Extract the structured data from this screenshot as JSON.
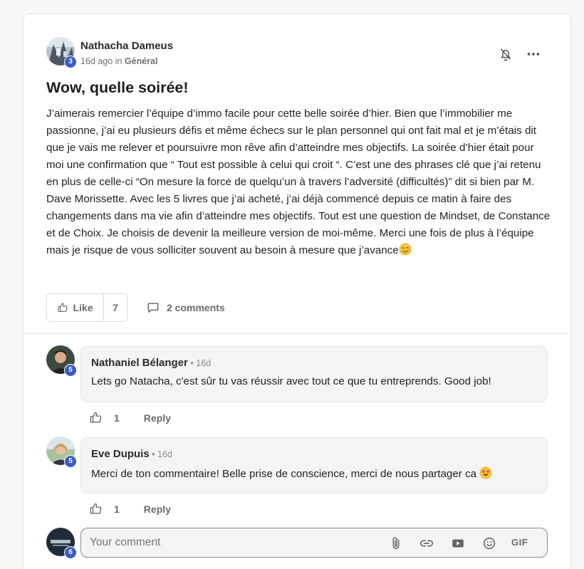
{
  "post": {
    "author": "Nathacha Dameus",
    "author_level": "3",
    "time": "16d ago",
    "in_word": "in",
    "category": "Général",
    "title": "Wow, quelle soirée!",
    "body": "J’aimerais remercier l’équipe d’immo facile pour cette belle soirée d’hier. Bien que l’immobilier me passionne, j’ai eu plusieurs défis et même échecs sur le plan personnel qui ont fait mal et je m’étais dit que je vais me relever et poursuivre mon rêve afin d’atteindre mes objectifs. La soirée d’hier était pour moi une confirmation que “ Tout est possible à celui qui croit “. C’est une des phrases clé que j’ai retenu en plus de celle-ci “On mesure la force de quelqu’un à travers l’adversité (difficultés)” dit si bien par M. Dave Morissette. Avec les 5 livres que j’ai acheté, j’ai déjà commencé depuis ce matin à faire des changements dans ma vie afin d’atteindre mes objectifs. Tout est une question de Mindset, de Constance et de Choix. Je choisis de devenir la meilleure version de moi-même. Merci une fois de plus à l’équipe mais je risque de vous solliciter souvent au besoin à mesure que j’avance",
    "body_emoji": "winking-face-emoji",
    "like_label": "Like",
    "like_count": "7",
    "comments_label": "2 comments"
  },
  "comments": [
    {
      "author": "Nathaniel Bélanger",
      "separator": " • ",
      "time": "16d",
      "level": "5",
      "text": "Lets go Natacha, c'est sûr tu vas réussir avec tout ce que tu entreprends. Good job!",
      "likes": "1",
      "reply_label": "Reply"
    },
    {
      "author": "Eve Dupuis",
      "separator": " • ",
      "time": "16d",
      "level": "5",
      "text": "Merci de ton commentaire! Belle prise de conscience, merci de nous partager ca ",
      "text_emoji": "star-struck-emoji",
      "likes": "1",
      "reply_label": "Reply"
    }
  ],
  "composer": {
    "placeholder": "Your comment",
    "user_level": "6",
    "gif_label": "GIF",
    "tools": [
      "paperclip-icon",
      "link-icon",
      "video-icon",
      "emoji-icon",
      "gif-button"
    ]
  },
  "colors": {
    "badge": "#3b5bc4",
    "text": "#222222",
    "muted": "#6a6a6a",
    "bubble": "#f4f4f4"
  }
}
